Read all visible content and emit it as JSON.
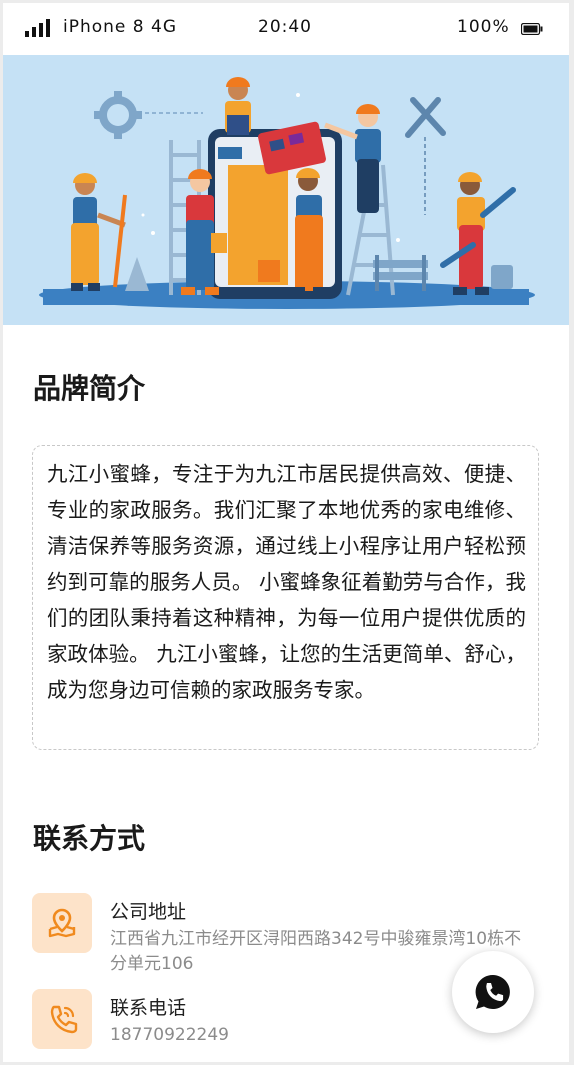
{
  "status_bar": {
    "carrier": "iPhone 8  4G",
    "time": "20:40",
    "battery": "100%"
  },
  "brand": {
    "title": "品牌简介",
    "description": "九江小蜜蜂，专注于为九江市居民提供高效、便捷、专业的家政服务。我们汇聚了本地优秀的家电维修、清洁保养等服务资源，通过线上小程序让用户轻松预约到可靠的服务人员。 小蜜蜂象征着勤劳与合作，我们的团队秉持着这种精神，为每一位用户提供优质的家政体验。 九江小蜜蜂，让您的生活更简单、舒心，成为您身边可信赖的家政服务专家。"
  },
  "contact": {
    "title": "联系方式",
    "items": [
      {
        "label": "公司地址",
        "value": "江西省九江市经开区浔阳西路342号中骏雍景湾10栋不分单元106",
        "icon": "location-map-icon"
      },
      {
        "label": "联系电话",
        "value": "18770922249",
        "icon": "phone-icon"
      }
    ]
  },
  "fab": {
    "icon": "chat-phone-icon"
  },
  "colors": {
    "hero_bg": "#c5e1f5",
    "icon_bg": "#fde3c9",
    "icon_fg": "#f08a1e",
    "text_primary": "#1a1a1a",
    "text_secondary": "#8b8b8b"
  }
}
